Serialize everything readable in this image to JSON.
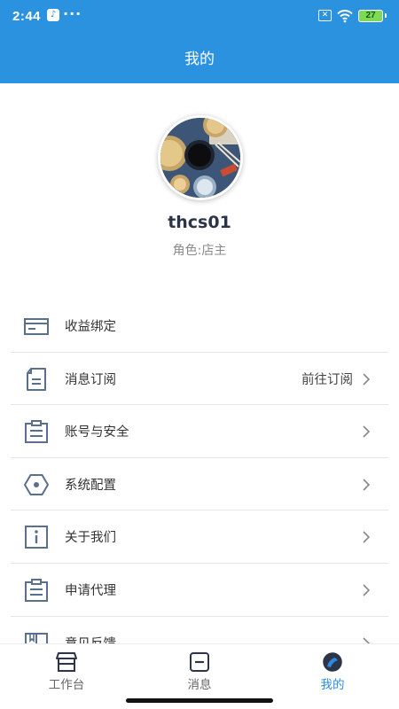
{
  "status_bar": {
    "time": "2:44",
    "app_badge": "♪",
    "more_dots": "···",
    "battery_level": "27"
  },
  "header": {
    "title": "我的"
  },
  "profile": {
    "username": "thcs01",
    "role": "角色:店主"
  },
  "menu": [
    {
      "label": "收益绑定",
      "value": "",
      "icon": "card-icon",
      "chevron": false
    },
    {
      "label": "消息订阅",
      "value": "前往订阅",
      "icon": "document-icon",
      "chevron": true
    },
    {
      "label": "账号与安全",
      "value": "",
      "icon": "clipboard-icon",
      "chevron": true
    },
    {
      "label": "系统配置",
      "value": "",
      "icon": "hex-nut-icon",
      "chevron": true
    },
    {
      "label": "关于我们",
      "value": "",
      "icon": "info-icon",
      "chevron": true
    },
    {
      "label": "申请代理",
      "value": "",
      "icon": "clipboard-icon",
      "chevron": true
    },
    {
      "label": "意见反馈",
      "value": "",
      "icon": "book-icon",
      "chevron": true
    }
  ],
  "tabs": [
    {
      "label": "工作台",
      "icon": "store-icon",
      "active": false
    },
    {
      "label": "消息",
      "icon": "message-icon",
      "active": false
    },
    {
      "label": "我的",
      "icon": "profile-icon",
      "active": true
    }
  ],
  "colors": {
    "header": "#2b92e0",
    "active_tab": "#2b8ae0",
    "icon_stroke": "#5a6f8c"
  }
}
